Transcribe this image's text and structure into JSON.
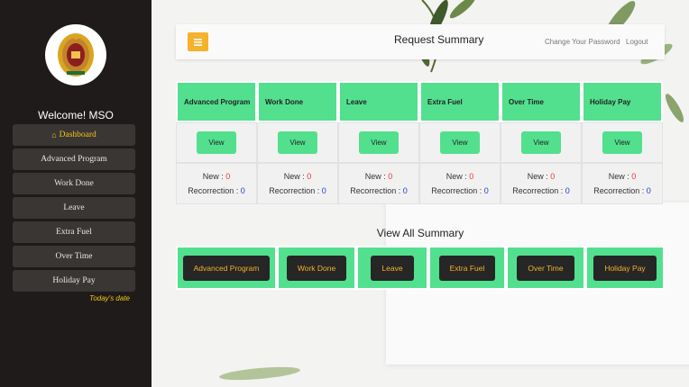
{
  "sidebar": {
    "welcome": "Welcome! MSO",
    "items": [
      {
        "label": "Dashboard",
        "icon": "home-icon",
        "active": true
      },
      {
        "label": "Advanced Program"
      },
      {
        "label": "Work Done"
      },
      {
        "label": "Leave"
      },
      {
        "label": "Extra Fuel"
      },
      {
        "label": "Over Time"
      },
      {
        "label": "Holiday Pay"
      }
    ],
    "today_label": "Today's date"
  },
  "header": {
    "menu_icon": "menu-icon",
    "title": "Request Summary",
    "change_password": "Change Your Password",
    "logout": "Logout"
  },
  "summary": {
    "columns": [
      {
        "title": "Advanced Program",
        "button": "View",
        "new_label": "New :",
        "new": "0",
        "recorrection_label": "Recorrection :",
        "recorrection": "0"
      },
      {
        "title": "Work Done",
        "button": "View",
        "new_label": "New :",
        "new": "0",
        "recorrection_label": "Recorrection :",
        "recorrection": "0"
      },
      {
        "title": "Leave",
        "button": "View",
        "new_label": "New :",
        "new": "0",
        "recorrection_label": "Recorrection :",
        "recorrection": "0"
      },
      {
        "title": "Extra Fuel",
        "button": "View",
        "new_label": "New :",
        "new": "0",
        "recorrection_label": "Recorrection :",
        "recorrection": "0"
      },
      {
        "title": "Over Time",
        "button": "View",
        "new_label": "New :",
        "new": "0",
        "recorrection_label": "Recorrection :",
        "recorrection": "0"
      },
      {
        "title": "Holiday Pay",
        "button": "View",
        "new_label": "New :",
        "new": "0",
        "recorrection_label": "Recorrection :",
        "recorrection": "0"
      }
    ]
  },
  "view_all": {
    "title": "View All Summary",
    "buttons": [
      "Advanced Program",
      "Work Done",
      "Leave",
      "Extra Fuel",
      "Over Time",
      "Holiday Pay"
    ]
  },
  "colors": {
    "sidebar_bg": "#1f1b1a",
    "accent_green": "#52e08e",
    "accent_yellow": "#f5b22b",
    "new_count": "#e53935",
    "recorrection_count": "#1e40c8"
  }
}
